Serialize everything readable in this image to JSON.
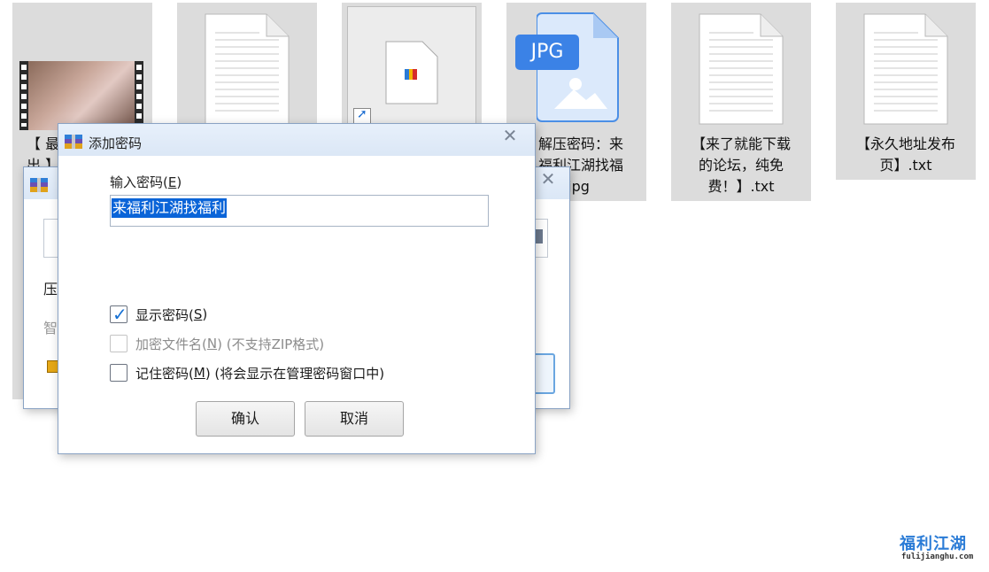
{
  "desktop": {
    "files": [
      {
        "label_line1": "【 最",
        "label_line2": "出 】",
        "icon": "video-thumbnail-icon"
      },
      {
        "label_line1": "",
        "icon": "text-document-icon"
      },
      {
        "label_line1": "",
        "icon": "shortcut-file-icon"
      },
      {
        "label_line1": "解压密码：来",
        "label_line2": "福利江湖找福",
        "label_line3": ".jpg",
        "icon": "jpg-file-icon",
        "badge": "JPG"
      },
      {
        "label_line1": "【来了就能下载",
        "label_line2": "的论坛，纯免",
        "label_line3": "费！】.txt",
        "icon": "text-document-icon"
      },
      {
        "label_line1": "【永久地址发布",
        "label_line2": "页】.txt",
        "icon": "text-document-icon"
      }
    ]
  },
  "background_dialog": {
    "partial_text_1": "压",
    "partial_text_2": "智",
    "title_partial": ""
  },
  "dialog": {
    "title": "添加密码",
    "input_label": "输入密码(",
    "input_label_key": "E",
    "input_label_end": ")",
    "password_value": "来福利江湖找福利",
    "show_password": {
      "label": "显示密码(",
      "key": "S",
      "end": ")",
      "checked": true
    },
    "encrypt_names": {
      "label": "加密文件名(",
      "key": "N",
      "end": ") (不支持ZIP格式)",
      "checked": false,
      "disabled": true
    },
    "remember_password": {
      "label": "记住密码(",
      "key": "M",
      "end": ") (将会显示在管理密码窗口中)",
      "checked": false
    },
    "ok_label": "确认",
    "cancel_label": "取消"
  },
  "watermark": {
    "text": "福利江湖",
    "sub": "fulijianghu.com"
  }
}
